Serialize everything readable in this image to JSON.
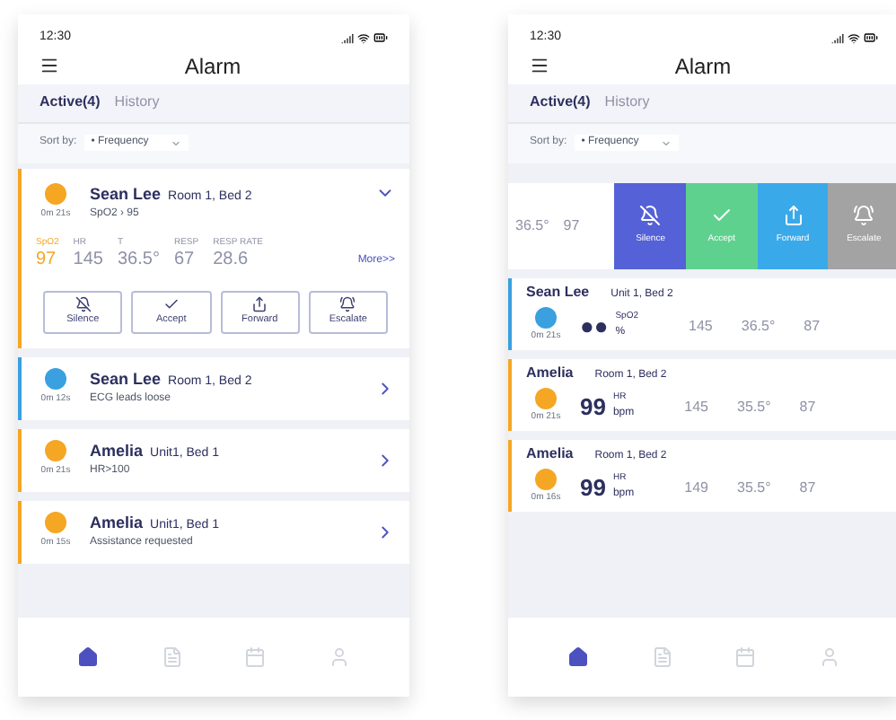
{
  "screens": [
    {
      "status_time": "12:30",
      "title": "Alarm",
      "tabs": [
        {
          "label": "Active(4)",
          "selected": true
        },
        {
          "label": "History",
          "selected": false
        }
      ],
      "sort": {
        "label": "Sort by:",
        "value": "• Frequency"
      },
      "alarms": [
        {
          "kind": "expanded",
          "name": "Sean Lee",
          "location": "Room 1, Bed 2",
          "detail": "SpO2 › 95",
          "time": "0m 21s",
          "color": "#f5a623",
          "vitals": [
            {
              "label": "SpO2",
              "value": "97",
              "highlight": true
            },
            {
              "label": "HR",
              "value": "145",
              "highlight": false
            },
            {
              "label": "T",
              "value": "36.5°",
              "highlight": false
            },
            {
              "label": "RESP",
              "value": "67",
              "highlight": false
            },
            {
              "label": "RESP RATE",
              "value": "28.6",
              "highlight": false
            }
          ],
          "more": "More>>",
          "actions": [
            {
              "label": "Silence",
              "kind": "silence"
            },
            {
              "label": "Accept",
              "kind": "accept"
            },
            {
              "label": "Forward",
              "kind": "forward"
            },
            {
              "label": "Escalate",
              "kind": "escalate"
            }
          ]
        },
        {
          "kind": "summary",
          "name": "Sean Lee",
          "location": "Room 1, Bed 2",
          "detail": "ECG leads loose",
          "time": "0m 12s",
          "color": "#3aa0e0"
        },
        {
          "kind": "summary",
          "name": "Amelia",
          "location": "Unit1, Bed 1",
          "detail": "HR>100",
          "time": "0m 21s",
          "color": "#f5a623"
        },
        {
          "kind": "summary",
          "name": "Amelia",
          "location": "Unit1, Bed 1",
          "detail": "Assistance requested",
          "time": "0m 15s",
          "color": "#f5a623"
        }
      ],
      "nav": [
        {
          "kind": "home",
          "selected": true
        },
        {
          "kind": "records",
          "selected": false
        },
        {
          "kind": "calendar",
          "selected": false
        },
        {
          "kind": "profile",
          "selected": false
        }
      ]
    },
    {
      "status_time": "12:30",
      "title": "Alarm",
      "tabs": [
        {
          "label": "Active(4)",
          "selected": true
        },
        {
          "label": "History",
          "selected": false
        }
      ],
      "sort": {
        "label": "Sort by:",
        "value": "• Frequency"
      },
      "swiped": {
        "vitals": [
          {
            "value": "36.5°"
          },
          {
            "value": "97"
          }
        ],
        "actions": [
          {
            "label": "Silence",
            "kind": "silence",
            "color": "#5561d6"
          },
          {
            "label": "Accept",
            "kind": "accept",
            "color": "#5fd18f"
          },
          {
            "label": "Forward",
            "kind": "forward",
            "color": "#3aa9ea"
          },
          {
            "label": "Escalate",
            "kind": "escalate",
            "color": "#a3a3a3"
          }
        ]
      },
      "alarms": [
        {
          "kind": "vitals",
          "name": "Sean Lee",
          "location": "Unit 1, Bed 2",
          "time": "0m 21s",
          "color": "#3aa0e0",
          "primary": {
            "value": "●●",
            "label": "SpO2",
            "unit": "%"
          },
          "vitals": [
            {
              "value": "145"
            },
            {
              "value": "36.5°"
            },
            {
              "value": "87"
            }
          ]
        },
        {
          "kind": "vitals",
          "name": "Amelia",
          "location": "Room 1, Bed 2",
          "time": "0m 21s",
          "color": "#f5a623",
          "primary": {
            "value": "99",
            "label": "HR",
            "unit": "bpm"
          },
          "vitals": [
            {
              "value": "145"
            },
            {
              "value": "35.5°"
            },
            {
              "value": "87"
            }
          ]
        },
        {
          "kind": "vitals",
          "name": "Amelia",
          "location": "Room 1, Bed 2",
          "time": "0m 16s",
          "color": "#f5a623",
          "primary": {
            "value": "99",
            "label": "HR",
            "unit": "bpm"
          },
          "vitals": [
            {
              "value": "149"
            },
            {
              "value": "35.5°"
            },
            {
              "value": "87"
            }
          ]
        }
      ],
      "nav": [
        {
          "kind": "home",
          "selected": true
        },
        {
          "kind": "records",
          "selected": false
        },
        {
          "kind": "calendar",
          "selected": false
        },
        {
          "kind": "profile",
          "selected": false
        }
      ]
    }
  ]
}
